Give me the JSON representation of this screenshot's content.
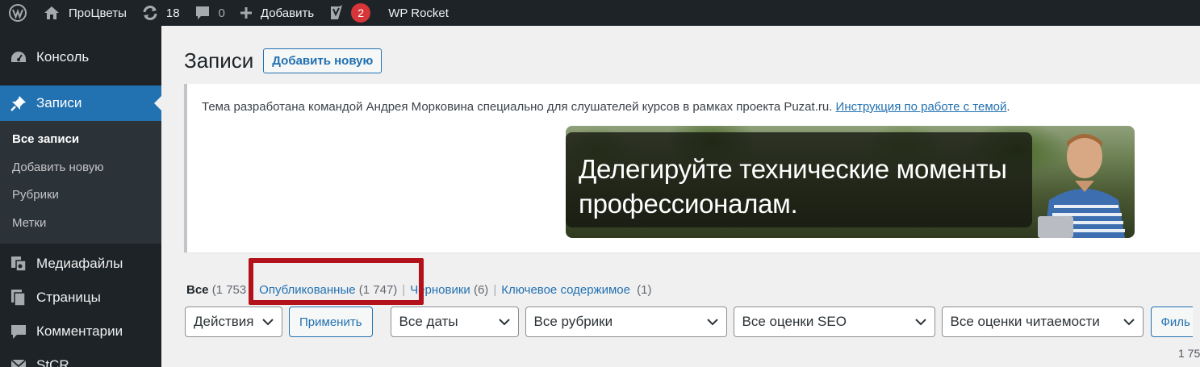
{
  "adminbar": {
    "site_name": "ПроЦветы",
    "updates_count": "18",
    "comments_count": "0",
    "add_label": "Добавить",
    "yoast_badge": "2",
    "rocket_label": "WP Rocket"
  },
  "sidebar": {
    "items": [
      {
        "label": "Консоль",
        "icon": "dashboard-icon"
      },
      {
        "label": "Записи",
        "icon": "pin-icon"
      },
      {
        "label": "Медиафайлы",
        "icon": "media-icon"
      },
      {
        "label": "Страницы",
        "icon": "pages-icon"
      },
      {
        "label": "Комментарии",
        "icon": "comment-icon"
      },
      {
        "label": "StCR",
        "icon": "mail-icon"
      }
    ],
    "submenu": [
      "Все записи",
      "Добавить новую",
      "Рубрики",
      "Метки"
    ]
  },
  "page": {
    "title": "Записи",
    "add_new": "Добавить новую"
  },
  "notice": {
    "text": "Тема разработана командой Андрея Морковина специально для слушателей курсов в рамках проекта Puzat.ru.",
    "link": "Инструкция по работе с темой",
    "period": ".",
    "banner_line1": "Делегируйте технические моменты",
    "banner_line2": "профессионалам."
  },
  "views": {
    "all": "Все",
    "all_count": "(1 753",
    "published": "Опубликованные",
    "published_count": "(1 747)",
    "drafts": "Черновики",
    "drafts_count": "(6)",
    "cornerstone": "Ключевое содержимое",
    "cornerstone_count": "(1)"
  },
  "filters": {
    "bulk_actions": "Действия",
    "apply": "Применить",
    "dates": "Все даты",
    "categories": "Все рубрики",
    "seo": "Все оценки SEO",
    "readability": "Все оценки читаемости",
    "filter_button": "Филь"
  },
  "items_count": "1 75",
  "colors": {
    "adminbar": "#1d2327",
    "accent": "#2271b1",
    "badge": "#d63638",
    "highlight": "#b3121a"
  }
}
